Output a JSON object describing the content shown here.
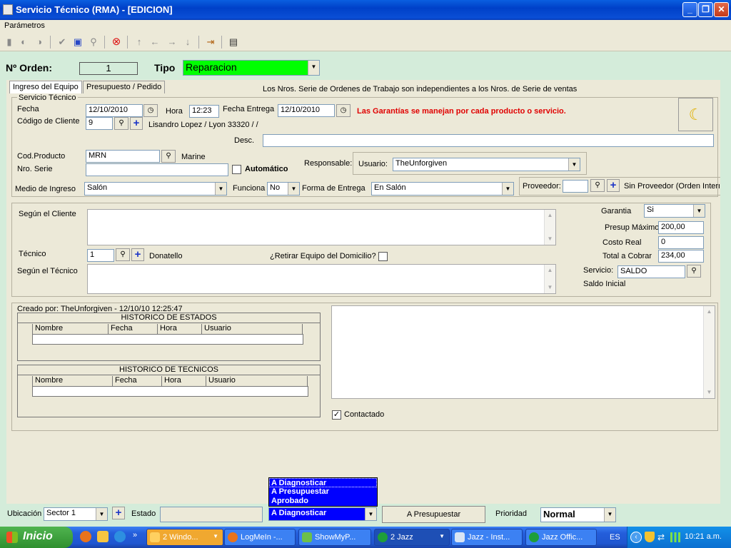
{
  "window": {
    "title": "Servicio Técnico (RMA) - [EDICION]",
    "menu": "Parámetros"
  },
  "toolbar": {
    "icons": [
      "new-icon",
      "back-icon",
      "forward-page-icon",
      "check-icon",
      "save-icon",
      "search-icon",
      "cancel-icon",
      "arrow-up-icon",
      "arrow-left-icon",
      "arrow-right-icon",
      "arrow-down-icon",
      "exit-icon",
      "grid-icon"
    ]
  },
  "header": {
    "orden_label": "Nº Orden:",
    "orden_value": "1",
    "tipo_label": "Tipo",
    "tipo_value": "Reparacion",
    "tipo_color": "#00ff00"
  },
  "tabs": [
    {
      "label": "Ingreso del Equipo"
    },
    {
      "label": "Presupuesto / Pedido"
    }
  ],
  "tab_note": "Los Nros. Serie de Ordenes de Trabajo son independientes a los Nros. de Serie de ventas",
  "servicio": {
    "group_label": "Servicio Técnico",
    "fecha_label": "Fecha",
    "fecha_value": "12/10/2010",
    "hora_label": "Hora",
    "hora_value": "12:23",
    "fecha_entrega_label": "Fecha Entrega",
    "fecha_entrega_value": "12/10/2010",
    "garantia_warning": "Las Garantías se manejan por cada producto o servicio.",
    "warning_color": "#e00000",
    "codigo_cliente_label": "Código de Cliente",
    "codigo_cliente_value": "9",
    "cliente_nombre": "Lisandro Lopez / Lyon 33320 /   /",
    "desc_label": "Desc.",
    "desc_value": "",
    "cod_producto_label": "Cod.Producto",
    "cod_producto_value": "MRN",
    "producto_nombre": "Marine",
    "nro_serie_label": "Nro. Serie",
    "nro_serie_value": "",
    "automatico_label": "Automático",
    "responsable_label": "Responsable:",
    "usuario_label": "Usuario:",
    "usuario_value": "TheUnforgiven",
    "medio_ingreso_label": "Medio de Ingreso",
    "medio_ingreso_value": "Salón",
    "funciona_label": "Funciona",
    "funciona_value": "No",
    "forma_entrega_label": "Forma de Entrega",
    "forma_entrega_value": "En Salón",
    "proveedor_label": "Proveedor:",
    "proveedor_value": "",
    "proveedor_nombre": "Sin Proveedor (Orden Intern"
  },
  "diagnostico": {
    "segun_cliente_label": "Según el Cliente",
    "segun_cliente_value": "",
    "tecnico_label": "Técnico",
    "tecnico_value": "1",
    "tecnico_nombre": "Donatello",
    "retirar_label": "¿Retirar Equipo del Domicilio?",
    "segun_tecnico_label": "Según el Técnico",
    "segun_tecnico_value": "",
    "garantia_label": "Garantia",
    "garantia_value": "Si",
    "presup_maximo_label": "Presup Máximo",
    "presup_maximo_value": "200,00",
    "costo_real_label": "Costo Real",
    "costo_real_value": "0",
    "total_cobrar_label": "Total a Cobrar",
    "total_cobrar_value": "234,00",
    "servicio_label": "Servicio:",
    "servicio_value": "SALDO",
    "saldo_inicial_label": "Saldo Inicial"
  },
  "historico": {
    "creado_por": "Creado por: TheUnforgiven - 12/10/10 12:25:47",
    "estados_title": "HISTORICO DE ESTADOS",
    "tecnicos_title": "HISTORICO DE TECNICOS",
    "columns": [
      "Nombre",
      "Fecha",
      "Hora",
      "Usuario"
    ],
    "contactado_label": "Contactado",
    "contactado_checked": "✓"
  },
  "estado_dropdown": {
    "options": [
      "A Diagnosticar",
      "A Presupuestar",
      "Aprobado"
    ],
    "selected": "A Diagnosticar",
    "highlight_color": "#0000ff"
  },
  "footer": {
    "ubicacion_label": "Ubicación",
    "ubicacion_value": "Sector 1",
    "estado_label": "Estado",
    "estado_value": "",
    "estado_select_value": "A Diagnosticar",
    "presupuestar_button": "A Presupuestar",
    "prioridad_label": "Prioridad",
    "prioridad_value": "Normal"
  },
  "taskbar": {
    "start_label": "Inicio",
    "tasks": [
      {
        "label": "2 Windo...",
        "name": "task-windows"
      },
      {
        "label": "LogMeIn -...",
        "name": "task-logmein"
      },
      {
        "label": "ShowMyP...",
        "name": "task-showmypc"
      },
      {
        "label": "2 Jazz",
        "name": "task-jazz"
      },
      {
        "label": "Jazz - Inst...",
        "name": "task-jazz-inst"
      },
      {
        "label": "Jazz Offic...",
        "name": "task-jazz-office"
      }
    ],
    "language": "ES",
    "clock": "10:21 a.m."
  }
}
